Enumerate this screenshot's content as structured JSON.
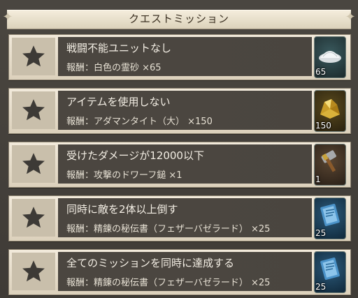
{
  "header": {
    "title": "クエストミッション"
  },
  "missions": [
    {
      "title": "戦闘不能ユニットなし",
      "reward": "報酬：白色の霊砂 ×65",
      "count": "65",
      "icon": "white-sand-icon"
    },
    {
      "title": "アイテムを使用しない",
      "reward": "報酬：アダマンタイト（大） ×150",
      "count": "150",
      "icon": "adamantite-icon"
    },
    {
      "title": "受けたダメージが12000以下",
      "reward": "報酬：攻撃のドワーフ鎚 ×1",
      "count": "1",
      "icon": "dwarf-hammer-icon"
    },
    {
      "title": "同時に敵を2体以上倒す",
      "reward": "報酬：精錬の秘伝書（フェザーバゼラード） ×25",
      "count": "25",
      "icon": "secret-book-icon"
    },
    {
      "title": "全てのミッションを同時に達成する",
      "reward": "報酬：精錬の秘伝書（フェザーバゼラード） ×25",
      "count": "25",
      "icon": "secret-book-icon"
    }
  ],
  "colors": {
    "panel": "#e8e0cf",
    "text_band": "#4b4640",
    "star": "#3d3a36"
  }
}
